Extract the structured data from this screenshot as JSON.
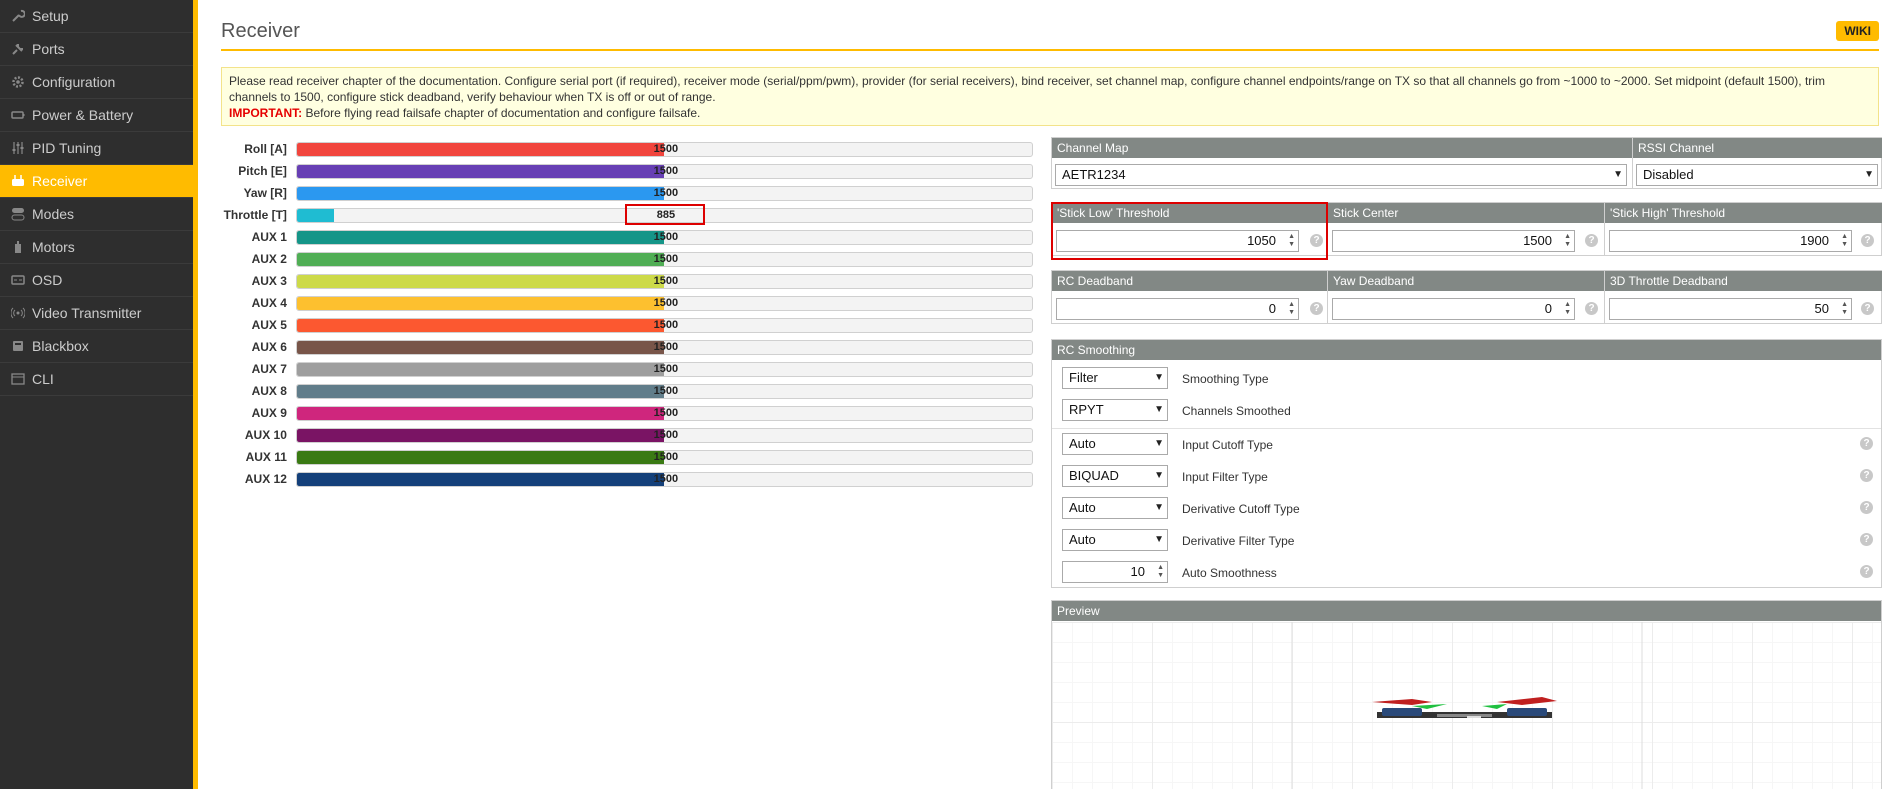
{
  "sidebar": {
    "items": [
      {
        "label": "Setup",
        "icon": "wrench-icon"
      },
      {
        "label": "Ports",
        "icon": "plug-icon"
      },
      {
        "label": "Configuration",
        "icon": "gear-icon"
      },
      {
        "label": "Power & Battery",
        "icon": "battery-icon"
      },
      {
        "label": "PID Tuning",
        "icon": "sliders-icon"
      },
      {
        "label": "Receiver",
        "icon": "receiver-icon",
        "active": true
      },
      {
        "label": "Modes",
        "icon": "toggles-icon"
      },
      {
        "label": "Motors",
        "icon": "motor-icon"
      },
      {
        "label": "OSD",
        "icon": "osd-icon"
      },
      {
        "label": "Video Transmitter",
        "icon": "antenna-icon"
      },
      {
        "label": "Blackbox",
        "icon": "blackbox-icon"
      },
      {
        "label": "CLI",
        "icon": "terminal-icon"
      }
    ]
  },
  "header": {
    "title": "Receiver",
    "wiki_label": "WIKI"
  },
  "note": {
    "text": "Please read receiver chapter of the documentation. Configure serial port (if required), receiver mode (serial/ppm/pwm), provider (for serial receivers), bind receiver, set channel map, configure channel endpoints/range on TX so that all channels go from ~1000 to ~2000. Set midpoint (default 1500), trim channels to 1500, configure stick deadband, verify behaviour when TX is off or out of range.",
    "important_label": "IMPORTANT:",
    "important_text": "Before flying read failsafe chapter of documentation and configure failsafe."
  },
  "channels": [
    {
      "label": "Roll [A]",
      "value": "1500",
      "fill": 0.5,
      "color": "#f1453d"
    },
    {
      "label": "Pitch [E]",
      "value": "1500",
      "fill": 0.5,
      "color": "#673fb4"
    },
    {
      "label": "Yaw [R]",
      "value": "1500",
      "fill": 0.5,
      "color": "#2b98f0"
    },
    {
      "label": "Throttle [T]",
      "value": "885",
      "fill": 0.05,
      "color": "#1fbcd2"
    },
    {
      "label": "AUX 1",
      "value": "1500",
      "fill": 0.5,
      "color": "#159588"
    },
    {
      "label": "AUX 2",
      "value": "1500",
      "fill": 0.5,
      "color": "#50ae55"
    },
    {
      "label": "AUX 3",
      "value": "1500",
      "fill": 0.5,
      "color": "#cdda49"
    },
    {
      "label": "AUX 4",
      "value": "1500",
      "fill": 0.5,
      "color": "#fdc02f"
    },
    {
      "label": "AUX 5",
      "value": "1500",
      "fill": 0.5,
      "color": "#fc5830"
    },
    {
      "label": "AUX 6",
      "value": "1500",
      "fill": 0.5,
      "color": "#785549"
    },
    {
      "label": "AUX 7",
      "value": "1500",
      "fill": 0.5,
      "color": "#9e9e9e"
    },
    {
      "label": "AUX 8",
      "value": "1500",
      "fill": 0.5,
      "color": "#617d8a"
    },
    {
      "label": "AUX 9",
      "value": "1500",
      "fill": 0.5,
      "color": "#cf267d"
    },
    {
      "label": "AUX 10",
      "value": "1500",
      "fill": 0.5,
      "color": "#7a1464"
    },
    {
      "label": "AUX 11",
      "value": "1500",
      "fill": 0.5,
      "color": "#3a7a14"
    },
    {
      "label": "AUX 12",
      "value": "1500",
      "fill": 0.5,
      "color": "#14407a"
    }
  ],
  "channel_map": {
    "label": "Channel Map",
    "value": "AETR1234"
  },
  "rssi": {
    "label": "RSSI Channel",
    "value": "Disabled"
  },
  "stick": {
    "low_label": "'Stick Low' Threshold",
    "low_value": "1050",
    "center_label": "Stick Center",
    "center_value": "1500",
    "high_label": "'Stick High' Threshold",
    "high_value": "1900"
  },
  "deadband": {
    "rc_label": "RC Deadband",
    "rc_value": "0",
    "yaw_label": "Yaw Deadband",
    "yaw_value": "0",
    "throttle3d_label": "3D Throttle Deadband",
    "throttle3d_value": "50"
  },
  "smoothing": {
    "title": "RC Smoothing",
    "rows": [
      {
        "value": "Filter",
        "label": "Smoothing Type"
      },
      {
        "value": "RPYT",
        "label": "Channels Smoothed"
      },
      {
        "value": "Auto",
        "label": "Input Cutoff Type"
      },
      {
        "value": "BIQUAD",
        "label": "Input Filter Type"
      },
      {
        "value": "Auto",
        "label": "Derivative Cutoff Type"
      },
      {
        "value": "Auto",
        "label": "Derivative Filter Type"
      },
      {
        "value": "10",
        "label": "Auto Smoothness"
      }
    ]
  },
  "preview": {
    "title": "Preview"
  },
  "help_glyph": "?"
}
